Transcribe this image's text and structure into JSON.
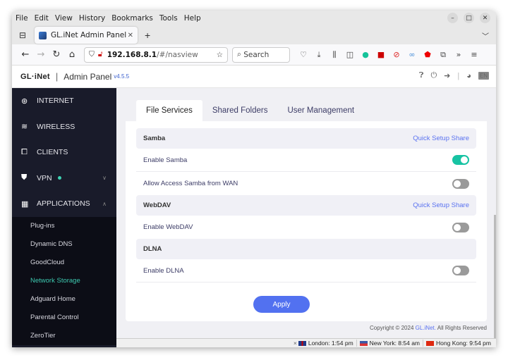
{
  "browser": {
    "menu": [
      "File",
      "Edit",
      "View",
      "History",
      "Bookmarks",
      "Tools",
      "Help"
    ],
    "tab_title": "GL.iNet Admin Panel",
    "url_host": "192.168.8.1",
    "url_path": "/#/nasview",
    "search_placeholder": "Search"
  },
  "header": {
    "logo": "GL·iNet",
    "title": "Admin Panel",
    "version": "v4.5.5",
    "lang": "EN"
  },
  "sidebar": {
    "items": [
      {
        "label": "INTERNET",
        "icon": "globe-icon"
      },
      {
        "label": "WIRELESS",
        "icon": "wifi-icon"
      },
      {
        "label": "CLIENTS",
        "icon": "devices-icon"
      },
      {
        "label": "VPN",
        "icon": "shield-icon"
      },
      {
        "label": "APPLICATIONS",
        "icon": "apps-icon"
      }
    ],
    "subitems": [
      "Plug-ins",
      "Dynamic DNS",
      "GoodCloud",
      "Network Storage",
      "Adguard Home",
      "Parental Control",
      "ZeroTier"
    ],
    "active_subitem": "Network Storage"
  },
  "main": {
    "tabs": [
      "File Services",
      "Shared Folders",
      "User Management"
    ],
    "active_tab": "File Services",
    "sections": {
      "samba": {
        "title": "Samba",
        "link": "Quick Setup Share",
        "rows": [
          {
            "label": "Enable Samba",
            "enabled": true
          },
          {
            "label": "Allow Access Samba from WAN",
            "enabled": false
          }
        ]
      },
      "webdav": {
        "title": "WebDAV",
        "link": "Quick Setup Share",
        "rows": [
          {
            "label": "Enable WebDAV",
            "enabled": false
          }
        ]
      },
      "dlna": {
        "title": "DLNA",
        "rows": [
          {
            "label": "Enable DLNA",
            "enabled": false
          }
        ]
      }
    },
    "apply_label": "Apply"
  },
  "footer": {
    "copyright_prefix": "Copyright © 2024",
    "brand": "GL.iNet.",
    "copyright_suffix": "All Rights Reserved"
  },
  "clocks": [
    {
      "label": "London: 1:54 pm"
    },
    {
      "label": "New York: 8:54 am"
    },
    {
      "label": "Hong Kong: 9:54 pm"
    }
  ],
  "colors": {
    "accent": "#5271f0",
    "toggle_on": "#17c3a3",
    "sidebar_bg": "#191b2a",
    "active_nav": "#3dc9b0"
  }
}
